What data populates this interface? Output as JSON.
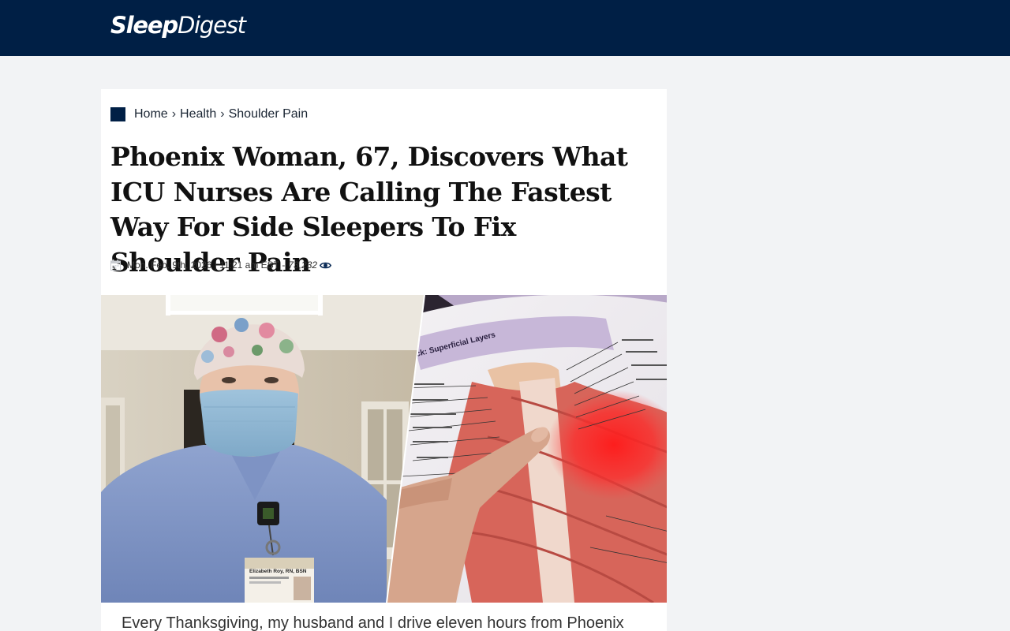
{
  "header": {
    "logo_part1": "Sleep",
    "logo_part2": "Digest"
  },
  "breadcrumb": {
    "items": [
      "Home",
      "Health",
      "Shoulder Pain"
    ],
    "separator": "›"
  },
  "article": {
    "headline": "Phoenix Woman, 67, Discovers What ICU Nurses Are Calling The Fastest Way For Side Sleepers To Fix Shoulder Pain",
    "date": "Mon. Feb. 9th, 2026",
    "time": "11:21 am EST",
    "views": "73,232",
    "body_first_line": "Every Thanksgiving, my husband and I drive eleven hours from Phoenix",
    "hero": {
      "badge_name": "Elizabeth Roy, RN, BSN",
      "book_heading": "ck: Superficial Layers"
    }
  },
  "colors": {
    "brand_navy": "#001f45",
    "page_bg": "#f2f3f5"
  }
}
